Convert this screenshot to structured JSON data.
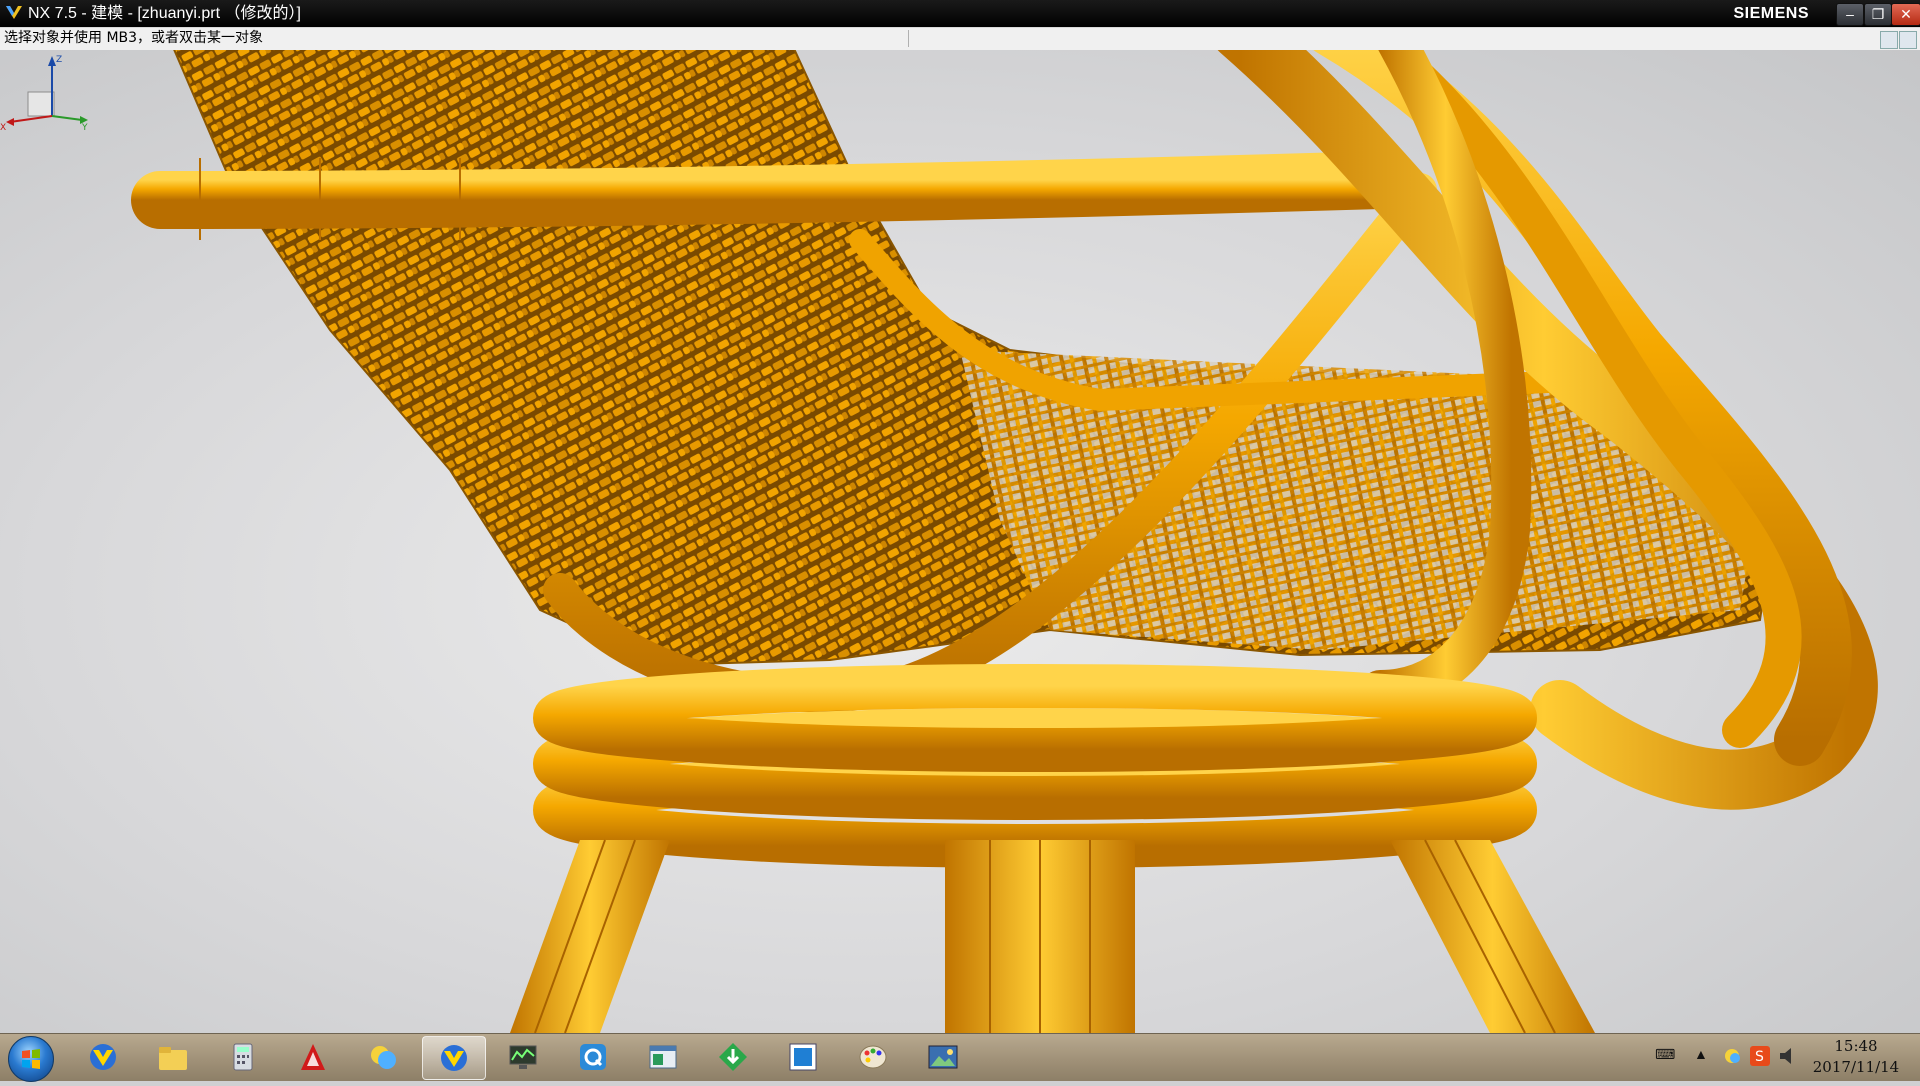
{
  "window": {
    "title": "NX 7.5 - 建模 - [zhuanyi.prt （修改的）]",
    "brand": "SIEMENS",
    "controls": {
      "minimize": "–",
      "restore": "❐",
      "close": "✕"
    }
  },
  "cue_line": {
    "message": "选择对象并使用 MB3，或者双击某一对象"
  },
  "viewport": {
    "model": "rattan-chair",
    "model_color": "#f5a800",
    "background": "#d8d8da",
    "triad_axes": [
      "Z",
      "X",
      "Y"
    ]
  },
  "taskbar": {
    "items": [
      {
        "icon": "nx-app-icon",
        "active": false
      },
      {
        "icon": "folder-icon",
        "active": false
      },
      {
        "icon": "calculator-icon",
        "active": false
      },
      {
        "icon": "autocad-icon",
        "active": false
      },
      {
        "icon": "chat-icon",
        "active": false
      },
      {
        "icon": "nx-app-icon",
        "active": true
      },
      {
        "icon": "monitor-icon",
        "active": false
      },
      {
        "icon": "q-icon",
        "active": false
      },
      {
        "icon": "window-icon",
        "active": false
      },
      {
        "icon": "download-icon",
        "active": false
      },
      {
        "icon": "blue-square-icon",
        "active": false
      },
      {
        "icon": "paint-icon",
        "active": false
      },
      {
        "icon": "picture-viewer-icon",
        "active": false
      }
    ],
    "tray_icons": [
      "keyboard-icon",
      "show-hidden-icon",
      "network-icon",
      "sogou-icon",
      "volume-icon"
    ],
    "clock": {
      "time": "15:48",
      "date": "2017/11/14"
    }
  }
}
